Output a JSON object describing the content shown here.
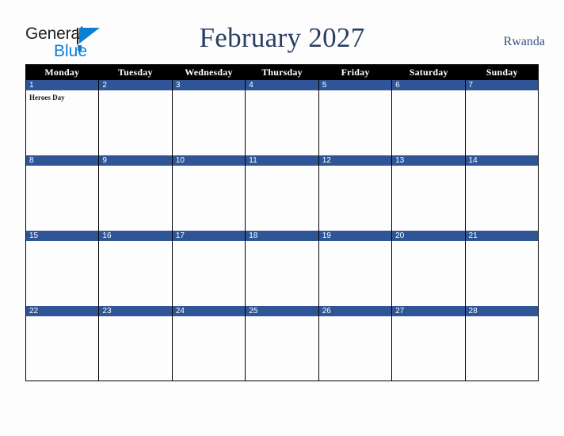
{
  "brand": {
    "name_part1": "General",
    "name_part2": "Blue",
    "triangle_color": "#0b7fd4",
    "text_color": "#231f20"
  },
  "header": {
    "title": "February 2027",
    "country": "Rwanda",
    "title_color": "#2b3f63",
    "country_color": "#3c5285"
  },
  "calendar": {
    "accent_band_color": "#2f5596",
    "header_bg_color": "#000000",
    "weekdays": [
      "Monday",
      "Tuesday",
      "Wednesday",
      "Thursday",
      "Friday",
      "Saturday",
      "Sunday"
    ],
    "weeks": [
      [
        {
          "day": "1",
          "events": [
            "Heroes Day"
          ]
        },
        {
          "day": "2",
          "events": []
        },
        {
          "day": "3",
          "events": []
        },
        {
          "day": "4",
          "events": []
        },
        {
          "day": "5",
          "events": []
        },
        {
          "day": "6",
          "events": []
        },
        {
          "day": "7",
          "events": []
        }
      ],
      [
        {
          "day": "8",
          "events": []
        },
        {
          "day": "9",
          "events": []
        },
        {
          "day": "10",
          "events": []
        },
        {
          "day": "11",
          "events": []
        },
        {
          "day": "12",
          "events": []
        },
        {
          "day": "13",
          "events": []
        },
        {
          "day": "14",
          "events": []
        }
      ],
      [
        {
          "day": "15",
          "events": []
        },
        {
          "day": "16",
          "events": []
        },
        {
          "day": "17",
          "events": []
        },
        {
          "day": "18",
          "events": []
        },
        {
          "day": "19",
          "events": []
        },
        {
          "day": "20",
          "events": []
        },
        {
          "day": "21",
          "events": []
        }
      ],
      [
        {
          "day": "22",
          "events": []
        },
        {
          "day": "23",
          "events": []
        },
        {
          "day": "24",
          "events": []
        },
        {
          "day": "25",
          "events": []
        },
        {
          "day": "26",
          "events": []
        },
        {
          "day": "27",
          "events": []
        },
        {
          "day": "28",
          "events": []
        }
      ]
    ]
  }
}
